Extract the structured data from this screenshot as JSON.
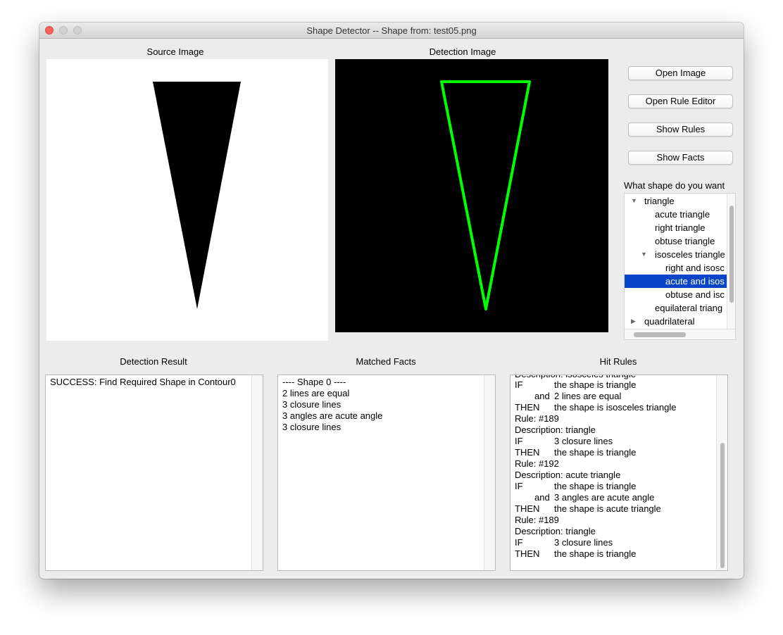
{
  "window": {
    "title": "Shape Detector -- Shape from: test05.png"
  },
  "labels": {
    "source_image": "Source Image",
    "detection_image": "Detection Image",
    "tree_prompt": "What shape do you want",
    "detection_result": "Detection Result",
    "matched_facts": "Matched Facts",
    "hit_rules": "Hit Rules"
  },
  "buttons": {
    "open_image": "Open Image",
    "open_rule_editor": "Open Rule Editor",
    "show_rules": "Show Rules",
    "show_facts": "Show Facts"
  },
  "tree": {
    "items": [
      {
        "label": "triangle",
        "expander": "expanded"
      },
      {
        "label": "acute triangle"
      },
      {
        "label": "right triangle"
      },
      {
        "label": "obtuse triangle"
      },
      {
        "label": "isosceles triangle",
        "expander": "expanded"
      },
      {
        "label": "right and isosc"
      },
      {
        "label": "acute and isos",
        "selected": true
      },
      {
        "label": "obtuse and isc"
      },
      {
        "label": "equilateral triang"
      },
      {
        "label": "quadrilateral",
        "expander": "collapsed"
      }
    ]
  },
  "detection_result": {
    "lines": [
      "SUCCESS: Find Required Shape in Contour0"
    ]
  },
  "matched_facts": {
    "lines": [
      "---- Shape 0 ----",
      "2 lines are equal",
      "3 closure lines",
      "3 angles are acute angle",
      "3 closure lines"
    ]
  },
  "hit_rules": {
    "partial_top_line": "Description: isosceles triangle",
    "lines": [
      {
        "kw": "IF",
        "text": "the shape is triangle"
      },
      {
        "kw": "and",
        "text": "2 lines are equal"
      },
      {
        "kw": "THEN",
        "text": "the shape is isosceles triangle"
      },
      {
        "text": "Rule: #189"
      },
      {
        "text": "Description: triangle"
      },
      {
        "kw": "IF",
        "text": "3 closure lines"
      },
      {
        "kw": "THEN",
        "text": "the shape is triangle"
      },
      {
        "text": "Rule: #192"
      },
      {
        "text": "Description: acute triangle"
      },
      {
        "kw": "IF",
        "text": "the shape is triangle"
      },
      {
        "kw": "and",
        "text": "3 angles are acute angle"
      },
      {
        "kw": "THEN",
        "text": "the shape is acute triangle"
      },
      {
        "text": "Rule: #189"
      },
      {
        "text": "Description: triangle"
      },
      {
        "kw": "IF",
        "text": "3 closure lines"
      },
      {
        "kw": "THEN",
        "text": "the shape is triangle"
      }
    ]
  },
  "colors": {
    "detection_outline": "#00ff00",
    "selection": "#0b45c7",
    "close_button": "#fc605b"
  }
}
